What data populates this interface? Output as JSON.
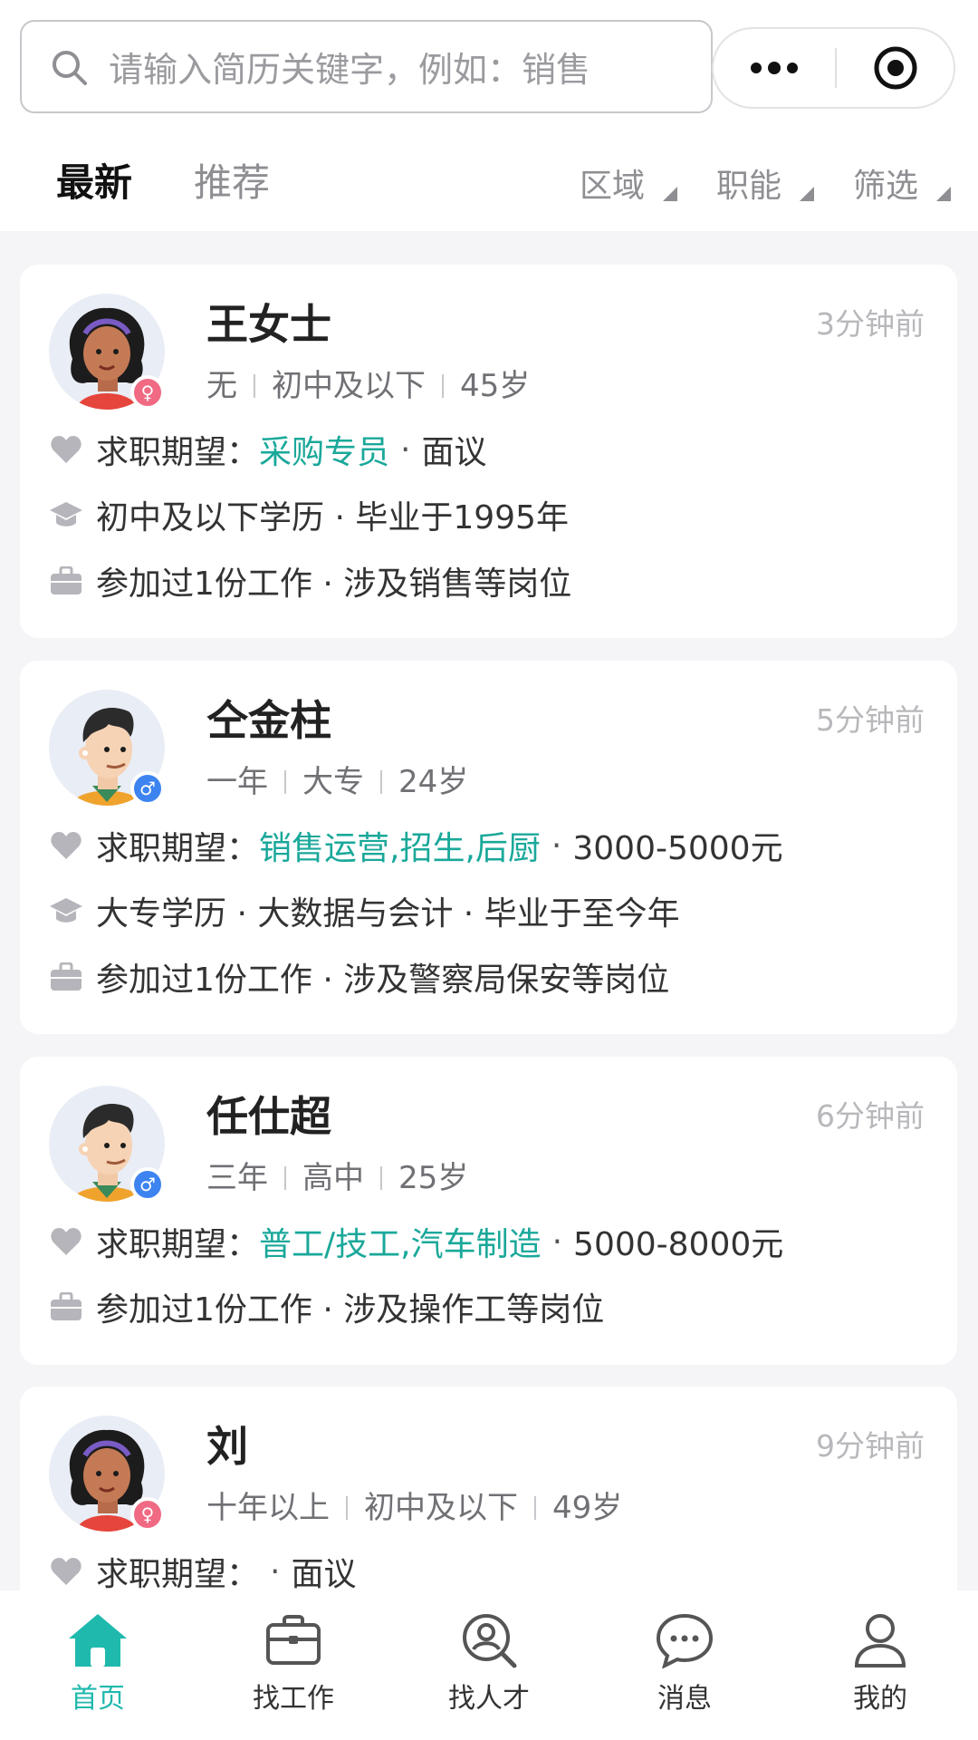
{
  "header": {
    "search_placeholder": "请输入简历关键字，例如：销售",
    "tabs": [
      {
        "label": "最新",
        "active": true
      },
      {
        "label": "推荐",
        "active": false
      }
    ],
    "filters": [
      "区域",
      "职能",
      "筛选"
    ]
  },
  "cards": [
    {
      "name": "王女士",
      "time": "3分钟前",
      "gender": "female",
      "meta": [
        "无",
        "初中及以下",
        "45岁"
      ],
      "expect_label": "求职期望：",
      "expect_job": "采购专员",
      "expect_salary": "面议",
      "edu": "初中及以下学历 · 毕业于1995年",
      "work": "参加过1份工作 · 涉及销售等岗位"
    },
    {
      "name": "仝金柱",
      "time": "5分钟前",
      "gender": "male",
      "meta": [
        "一年",
        "大专",
        "24岁"
      ],
      "expect_label": "求职期望：",
      "expect_job": "销售运营,招生,后厨",
      "expect_salary": "3000-5000元",
      "edu": "大专学历 · 大数据与会计 · 毕业于至今年",
      "work": "参加过1份工作 · 涉及警察局保安等岗位"
    },
    {
      "name": "任仕超",
      "time": "6分钟前",
      "gender": "male",
      "meta": [
        "三年",
        "高中",
        "25岁"
      ],
      "expect_label": "求职期望：",
      "expect_job": "普工/技工,汽车制造",
      "expect_salary": "5000-8000元",
      "work": "参加过1份工作 · 涉及操作工等岗位"
    },
    {
      "name": "刘",
      "time": "9分钟前",
      "gender": "female",
      "meta": [
        "十年以上",
        "初中及以下",
        "49岁"
      ],
      "expect_label": "求职期望：",
      "expect_job": "",
      "expect_salary": "面议"
    }
  ],
  "tabbar": [
    {
      "label": "首页",
      "icon": "home-icon",
      "active": true
    },
    {
      "label": "找工作",
      "icon": "briefcase-icon",
      "active": false
    },
    {
      "label": "找人才",
      "icon": "search-person-icon",
      "active": false
    },
    {
      "label": "消息",
      "icon": "chat-bubble-icon",
      "active": false
    },
    {
      "label": "我的",
      "icon": "user-icon",
      "active": false
    }
  ],
  "colors": {
    "accent": "#1fb9ad",
    "highlight_text": "#1aa89a",
    "female_badge": "#f06a84",
    "male_badge": "#3d84f0"
  }
}
